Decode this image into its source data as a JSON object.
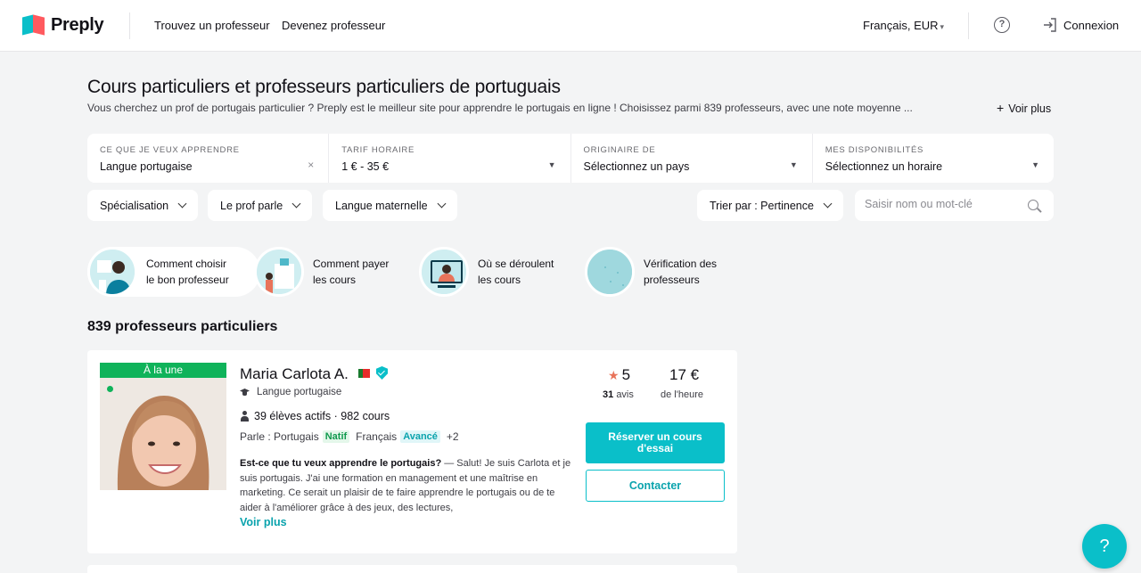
{
  "header": {
    "brand": "Preply",
    "nav": [
      "Trouvez un professeur",
      "Devenez professeur"
    ],
    "language_currency": "Français, EUR",
    "login": "Connexion"
  },
  "page": {
    "title": "Cours particuliers et professeurs particuliers de portuguais",
    "subtitle": "Vous cherchez un prof de portugais particulier ? Preply est le meilleur site pour apprendre le portugais en ligne ! Choisissez parmi 839 professeurs, avec une note moyenne ...",
    "see_more": "Voir plus"
  },
  "filters": {
    "subject": {
      "label": "CE QUE JE VEUX APPRENDRE",
      "value": "Langue portugaise"
    },
    "price": {
      "label": "TARIF HORAIRE",
      "value": "1 € - 35 €"
    },
    "origin": {
      "label": "ORIGINAIRE DE",
      "value": "Sélectionnez un pays"
    },
    "availability": {
      "label": "MES DISPONIBILITÉS",
      "value": "Sélectionnez un horaire"
    },
    "pills": {
      "specialization": "Spécialisation",
      "tutor_speaks": "Le prof parle",
      "native_language": "Langue maternelle",
      "sort": "Trier par : Pertinence"
    },
    "search_placeholder": "Saisir nom ou mot-clé"
  },
  "info_tiles": [
    {
      "label": "Comment choisir le bon professeur"
    },
    {
      "label": "Comment payer les cours"
    },
    {
      "label": "Où se déroulent les cours"
    },
    {
      "label": "Vérification des professeurs"
    }
  ],
  "results": {
    "count_label": "839 professeurs particuliers"
  },
  "tutor": {
    "badge": "À la une",
    "name": "Maria Carlota A.",
    "subject": "Langue portugaise",
    "stats": "39 élèves actifs · 982 cours",
    "speaks_prefix": "Parle : Portugais",
    "native_tag": "Natif",
    "second_language": "Français",
    "advanced_tag": "Avancé",
    "more_languages": "+2",
    "desc_bold": "Est-ce que tu veux apprendre le portugais?",
    "desc_rest": " — Salut! Je suis Carlota et je suis portugais. J'ai une formation en management et une maîtrise en marketing. Ce serait un plaisir de te faire apprendre le portugais ou de te aider à l'améliorer grâce à des jeux, des lectures,",
    "see_more": "Voir plus",
    "rating": "5",
    "reviews_count": "31",
    "reviews_word": "avis",
    "price": "17 €",
    "price_unit": "de l'heure",
    "book_button": "Réserver un cours d'essai",
    "contact_button": "Contacter"
  },
  "help_fab": "?",
  "colors": {
    "accent": "#0abfc9",
    "featured": "#0fb35a",
    "brand_red": "#ff5a5f"
  }
}
